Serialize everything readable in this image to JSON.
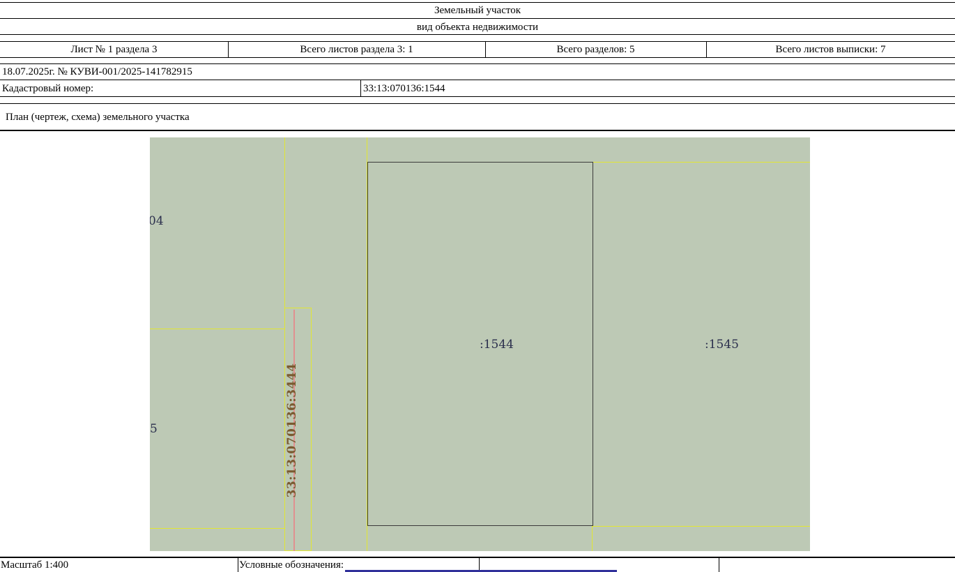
{
  "header": {
    "object_type": "Земельный участок",
    "object_kind_caption": "вид объекта недвижимости"
  },
  "sheet_info": [
    "Лист № 1 раздела 3",
    "Всего листов раздела 3: 1",
    "Всего разделов: 5",
    "Всего листов выписки: 7"
  ],
  "statement": "18.07.2025г. № КУВИ-001/2025-141782915",
  "cadastral": {
    "label": "Кадастровый номер:",
    "value": "33:13:070136:1544"
  },
  "plan_title": "План (чертеж, схема) земельного участка",
  "map": {
    "background_color": "#bdc9b5",
    "boundary_color": "#e2e632",
    "labels": {
      "left_top": "04",
      "left_bottom": "5",
      "main_parcel": ":1544",
      "right_parcel": ":1545",
      "vertical_parcel": "33:13:070136:3444"
    }
  },
  "footer": {
    "scale": "Масштаб 1:400",
    "legend_label": "Условные обозначения:"
  }
}
